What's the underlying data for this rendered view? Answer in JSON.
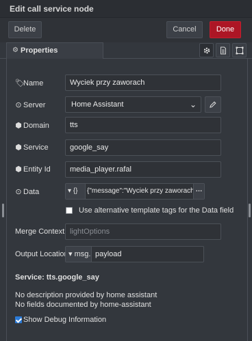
{
  "titlebar": {
    "title": "Edit call service node"
  },
  "buttons": {
    "delete": "Delete",
    "cancel": "Cancel",
    "done": "Done"
  },
  "tabs": {
    "properties": "Properties",
    "icons": [
      "gear-icon",
      "description-icon",
      "appearance-icon"
    ]
  },
  "form": {
    "name": {
      "label": "Name",
      "value": "Wyciek przy zaworach",
      "icon": "tag-icon"
    },
    "server": {
      "label": "Server",
      "value": "Home Assistant",
      "icon": "dot-circle-icon"
    },
    "domain": {
      "label": "Domain",
      "value": "tts",
      "icon": "cube-icon"
    },
    "service": {
      "label": "Service",
      "value": "google_say",
      "icon": "cube-icon"
    },
    "entity_id": {
      "label": "Entity Id",
      "value": "media_player.rafal",
      "icon": "cube-icon"
    },
    "data": {
      "label": "Data",
      "type": "{}",
      "value": "{\"message\":\"Wyciek przy zaworach!",
      "icon": "dot-circle-icon"
    },
    "alt_tags": {
      "label": "Use alternative template tags for the Data field",
      "checked": false
    },
    "merge_context": {
      "label": "Merge Context",
      "placeholder": "lightOptions"
    },
    "output_location": {
      "label": "Output Location",
      "type": "msg.",
      "value": "payload"
    }
  },
  "info": {
    "service": "Service: tts.google_say",
    "no_description": "No description provided by home assistant",
    "no_fields": "No fields documented by home-assistant"
  },
  "debug": {
    "label": "Show Debug Information",
    "checked": true
  },
  "colors": {
    "done": "#ad1625",
    "background": "#33373d",
    "checkbox": "#2b7bd8"
  }
}
